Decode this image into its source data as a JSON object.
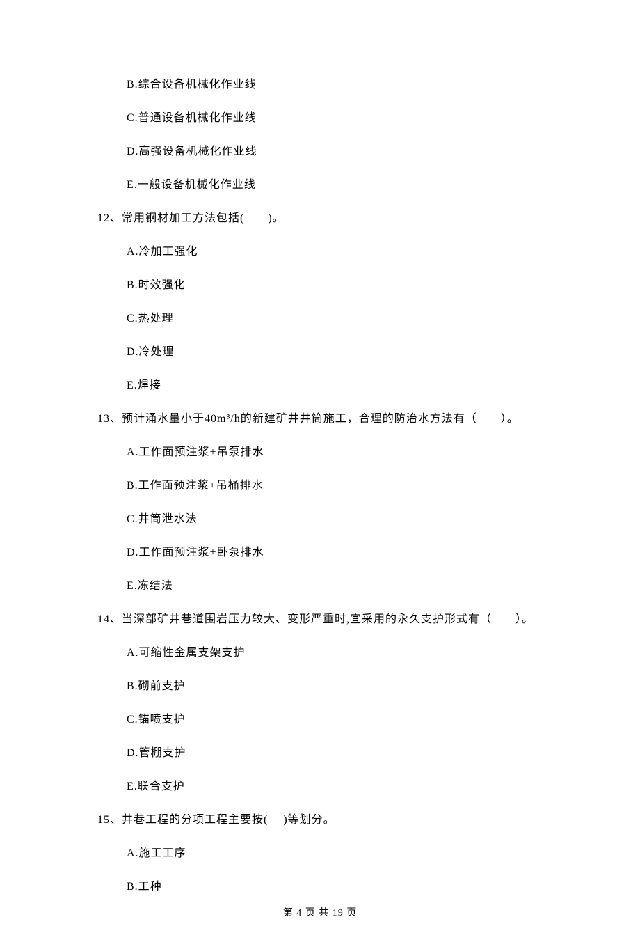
{
  "orphan_options": [
    "B.综合设备机械化作业线",
    "C.普通设备机械化作业线",
    "D.高强设备机械化作业线",
    "E.一般设备机械化作业线"
  ],
  "questions": [
    {
      "stem": "12、常用钢材加工方法包括(　　)。",
      "options": [
        "A.冷加工强化",
        "B.时效强化",
        "C.热处理",
        "D.冷处理",
        "E.焊接"
      ]
    },
    {
      "stem": "13、预计涌水量小于40m³/h的新建矿井井筒施工，合理的防治水方法有（　　）。",
      "options": [
        "A.工作面预注浆+吊泵排水",
        "B.工作面预注浆+吊桶排水",
        "C.井筒泄水法",
        "D.工作面预注浆+卧泵排水",
        "E.冻结法"
      ]
    },
    {
      "stem": "14、当深部矿井巷道围岩压力较大、变形严重时,宜采用的永久支护形式有（　　）。",
      "options": [
        "A.可缩性金属支架支护",
        "B.砌前支护",
        "C.锚喷支护",
        "D.管棚支护",
        "E.联合支护"
      ]
    },
    {
      "stem": "15、井巷工程的分项工程主要按(　  )等划分。",
      "options": [
        "A.施工工序",
        "B.工种"
      ]
    }
  ],
  "footer": "第 4 页 共 19 页"
}
